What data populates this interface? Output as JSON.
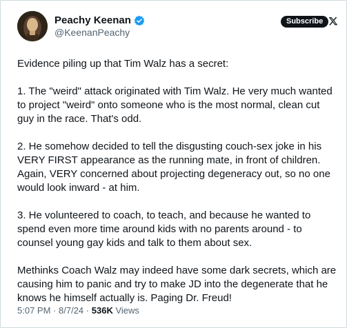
{
  "author": {
    "display_name": "Peachy Keenan",
    "handle": "@KeenanPeachy",
    "verified": true
  },
  "header": {
    "subscribe_label": "Subscribe"
  },
  "post": {
    "paragraphs": [
      "Evidence piling up that Tim Walz has a secret:",
      "1. The \"weird\" attack originated with Tim Walz. He very much wanted to project \"weird\" onto someone who is the most normal, clean cut guy in the race. That's odd.",
      "2. He somehow decided to tell the disgusting couch-sex joke in his VERY FIRST appearance as the running mate, in front of children. Again, VERY concerned about projecting degeneracy out, so no one would look inward - at him.",
      "3. He volunteered to coach, to teach, and because he wanted to spend even more time around kids with no parents around - to counsel young gay kids and talk to them about sex.",
      "Methinks Coach Walz may indeed have some dark secrets, which are causing him to panic and try to make JD into the degenerate that he knows he himself actually is. Paging Dr. Freud!"
    ]
  },
  "meta": {
    "time": "5:07 PM",
    "separator": "·",
    "date": "8/7/24",
    "views_count": "536K",
    "views_label": "Views"
  },
  "colors": {
    "text": "#0f1419",
    "secondary": "#536471",
    "verified": "#1d9bf0",
    "border": "#cfd9de"
  },
  "icons": {
    "verified": "verified-badge-icon",
    "logo": "x-logo-icon"
  }
}
